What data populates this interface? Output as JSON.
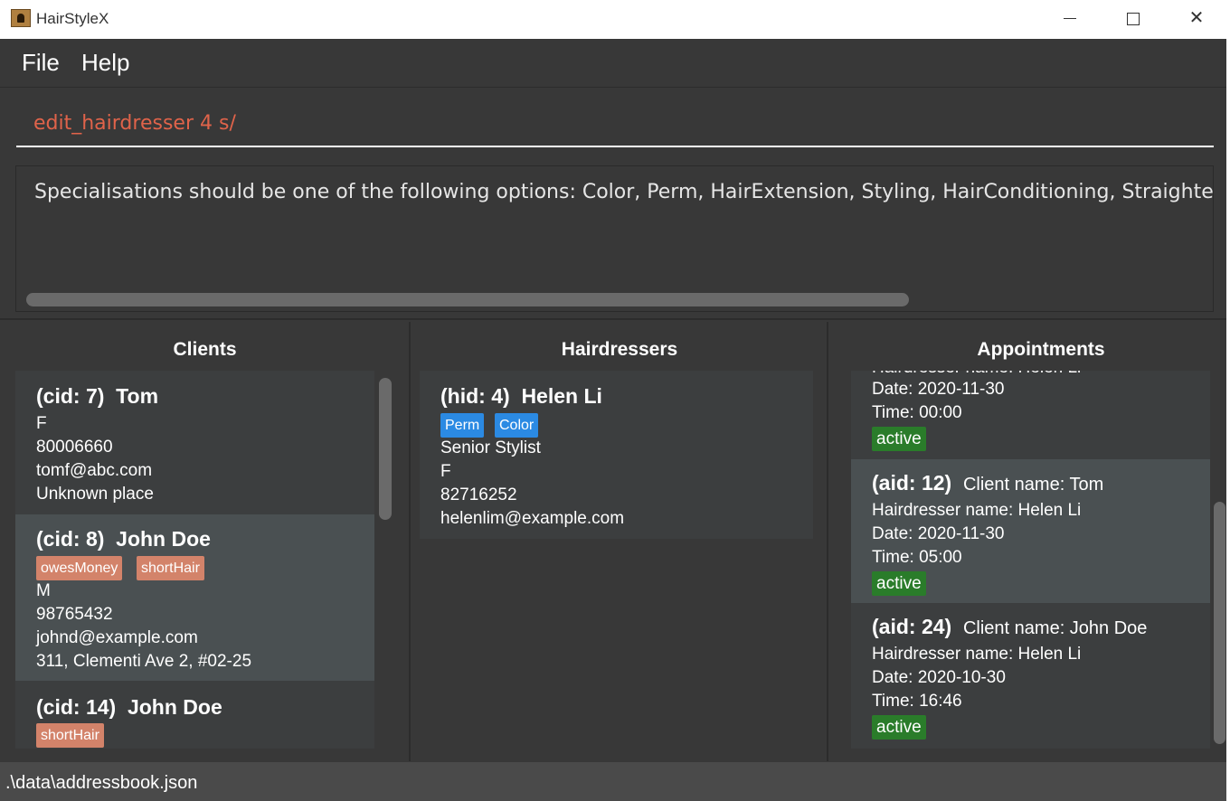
{
  "window": {
    "title": "HairStyleX"
  },
  "menu": {
    "file": "File",
    "help": "Help"
  },
  "command": {
    "value": "edit_hairdresser 4 s/"
  },
  "result": {
    "text": "Specialisations should be one of the following options: Color, Perm, HairExtension, Styling, HairConditioning, Straightening"
  },
  "panels": {
    "clients": "Clients",
    "hairdressers": "Hairdressers",
    "appointments": "Appointments"
  },
  "clients": [
    {
      "id": "(cid: 7)",
      "name": "Tom",
      "tags": [],
      "gender": "F",
      "phone": "80006660",
      "email": "tomf@abc.com",
      "address": "Unknown place"
    },
    {
      "id": "(cid: 8)",
      "name": "John Doe",
      "tags": [
        "owesMoney",
        "shortHair"
      ],
      "gender": "M",
      "phone": "98765432",
      "email": "johnd@example.com",
      "address": "311, Clementi Ave 2, #02-25"
    },
    {
      "id": "(cid: 14)",
      "name": "John Doe",
      "tags": [
        "shortHair"
      ]
    }
  ],
  "hairdressers": [
    {
      "id": "(hid: 4)",
      "name": "Helen Li",
      "tags": [
        "Perm",
        "Color"
      ],
      "title": "Senior Stylist",
      "gender": "F",
      "phone": "82716252",
      "email": "helenlim@example.com"
    }
  ],
  "appointments": [
    {
      "hairdresser": "Hairdresser name: Helen Li",
      "date": "Date: 2020-11-30",
      "time": "Time: 00:00",
      "status": "active"
    },
    {
      "id": "(aid: 12)",
      "client": "Client name: Tom",
      "hairdresser": "Hairdresser name: Helen Li",
      "date": "Date: 2020-11-30",
      "time": "Time: 05:00",
      "status": "active"
    },
    {
      "id": "(aid: 24)",
      "client": "Client name: John Doe",
      "hairdresser": "Hairdresser name: Helen Li",
      "date": "Date: 2020-10-30",
      "time": "Time: 16:46",
      "status": "active"
    }
  ],
  "status": {
    "path": ".\\data\\addressbook.json"
  },
  "colors": {
    "background": "#383838",
    "tag_client": "#d3836a",
    "tag_specialisation": "#2b8ae3",
    "tag_status": "#2a7c2a",
    "command_text": "#e0634a"
  }
}
